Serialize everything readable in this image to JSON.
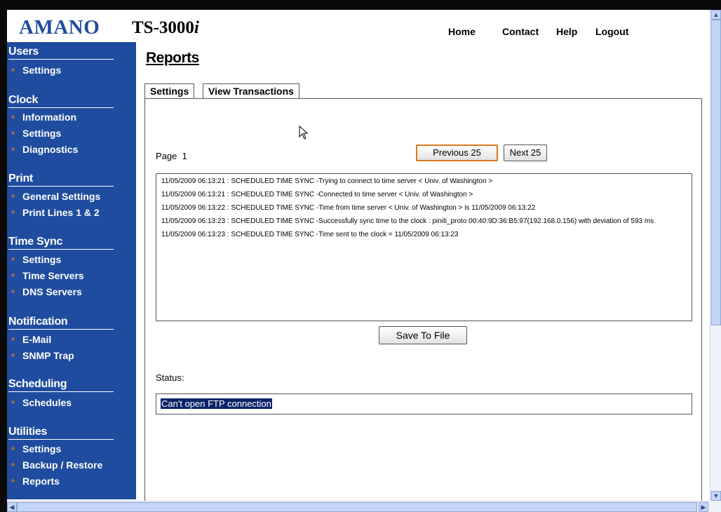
{
  "header": {
    "brand": "AMANO",
    "model": "TS-3000",
    "model_suffix": "i",
    "nav": [
      "Home",
      "Contact",
      "Help",
      "Logout"
    ]
  },
  "sidebar": [
    {
      "title": "Users",
      "items": [
        "Settings"
      ]
    },
    {
      "title": "Clock",
      "items": [
        "Information",
        "Settings",
        "Diagnostics"
      ]
    },
    {
      "title": "Print",
      "items": [
        "General Settings",
        "Print Lines 1 & 2"
      ]
    },
    {
      "title": "Time Sync",
      "items": [
        "Settings",
        "Time Servers",
        "DNS Servers"
      ]
    },
    {
      "title": "Notification",
      "items": [
        "E-Mail",
        "SNMP Trap"
      ]
    },
    {
      "title": "Scheduling",
      "items": [
        "Schedules"
      ]
    },
    {
      "title": "Utilities",
      "items": [
        "Settings",
        "Backup / Restore",
        "Reports"
      ]
    }
  ],
  "main": {
    "title": "Reports",
    "tabs": [
      "Settings",
      "View Transactions"
    ],
    "active_tab": "View Transactions",
    "page_label": "Page",
    "page_number": "1",
    "prev_button": "Previous 25",
    "next_button": "Next 25",
    "log_lines": [
      "11/05/2009 06:13:21 : SCHEDULED TIME SYNC -Trying to connect to time server < Univ. of Washington >",
      "11/05/2009 06:13:21 : SCHEDULED TIME SYNC -Connected to time server < Univ. of Washington >",
      "11/05/2009 06:13:22 : SCHEDULED TIME SYNC -Time from time server < Univ. of Washington > is 11/05/2009 06:13:22",
      "11/05/2009 06:13:23 : SCHEDULED TIME SYNC -Successfully sync time to the clock : piniti_proto 00:40:9D:36:B5:97(192.168.0.156) with deviation of 593 ms",
      "11/05/2009 06:13:23 : SCHEDULED TIME SYNC -Time sent to the clock = 11/05/2009 06:13:23"
    ],
    "save_button": "Save To File",
    "status_label": "Status:",
    "status_value": "Can't open FTP connection"
  },
  "colors": {
    "brand_blue": "#1f4c9e",
    "focus_orange": "#d87a20",
    "selection": "#0a246a"
  }
}
